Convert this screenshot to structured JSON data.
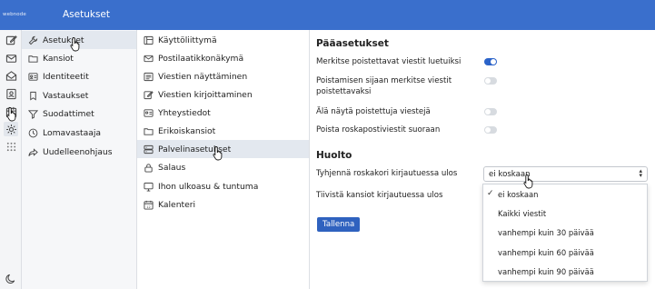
{
  "app": {
    "logo": "webnode",
    "title": "Asetukset"
  },
  "rail": [
    {
      "icon": "compose-icon"
    },
    {
      "icon": "envelope-icon"
    },
    {
      "icon": "open-envelope-icon"
    },
    {
      "icon": "contacts-icon"
    },
    {
      "icon": "calendar-icon"
    },
    {
      "icon": "settings-icon"
    },
    {
      "icon": "apps-grid-icon"
    },
    {
      "icon": "moon-icon"
    }
  ],
  "settings_nav": [
    {
      "label": "Asetukset",
      "icon": "wrench-icon"
    },
    {
      "label": "Kansiot",
      "icon": "folder-icon"
    },
    {
      "label": "Identiteetit",
      "icon": "id-card-icon"
    },
    {
      "label": "Vastaukset",
      "icon": "bookmark-icon"
    },
    {
      "label": "Suodattimet",
      "icon": "filter-icon"
    },
    {
      "label": "Lomavastaaja",
      "icon": "clock-icon"
    },
    {
      "label": "Uudelleenohjaus",
      "icon": "forward-icon"
    }
  ],
  "pref_sections": [
    {
      "label": "Käyttöliittymä",
      "icon": "layout-icon"
    },
    {
      "label": "Postilaatikkonäkymä",
      "icon": "envelope-icon"
    },
    {
      "label": "Viestien näyttäminen",
      "icon": "message-icon"
    },
    {
      "label": "Viestien kirjoittaminen",
      "icon": "compose-icon"
    },
    {
      "label": "Yhteystiedot",
      "icon": "id-card-icon"
    },
    {
      "label": "Erikoiskansiot",
      "icon": "folder-icon"
    },
    {
      "label": "Palvelinasetukset",
      "icon": "server-icon"
    },
    {
      "label": "Salaus",
      "icon": "lock-icon"
    },
    {
      "label": "Ihon ulkoasu & tuntuma",
      "icon": "monitor-icon"
    },
    {
      "label": "Kalenteri",
      "icon": "calendar-icon"
    }
  ],
  "main": {
    "section1_title": "Pääasetukset",
    "toggles": [
      {
        "label": "Merkitse poistettavat viestit luetuiksi",
        "on": true
      },
      {
        "label": "Poistamisen sijaan merkitse viestit poistettavaksi",
        "on": false
      },
      {
        "label": "Älä näytä poistettuja viestejä",
        "on": false
      },
      {
        "label": "Poista roskapostiviestit suoraan",
        "on": false
      }
    ],
    "section2_title": "Huolto",
    "empty_trash_label": "Tyhjennä roskakori kirjautuessa ulos",
    "compact_label": "Tiivistä kansiot kirjautuessa ulos",
    "select_value": "ei koskaan",
    "options": [
      "ei koskaan",
      "Kaikki viestit",
      "vanhempi kuin 30 päivää",
      "vanhempi kuin 60 päivää",
      "vanhempi kuin 90 päivää"
    ],
    "selected_option": "ei koskaan",
    "save_label": "Tallenna"
  }
}
